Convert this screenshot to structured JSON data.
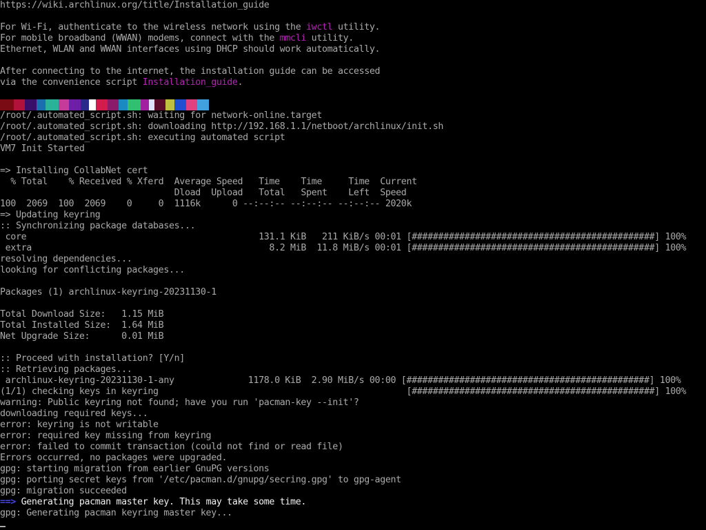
{
  "banner": {
    "url": "https://wiki.archlinux.org/title/Installation_guide",
    "wifi_pre": "For Wi-Fi, authenticate to the wireless network using the ",
    "wifi_tool": "iwctl",
    "wifi_post": " utility.",
    "wwan_pre": "For mobile broadband (WWAN) modems, connect with the ",
    "wwan_tool": "mmcli",
    "wwan_post": " utility.",
    "dhcp": "Ethernet, WLAN and WWAN interfaces using DHCP should work automatically.",
    "guide_line1": "After connecting to the internet, the installation guide can be accessed",
    "guide_pre": "via the convenience script ",
    "guide_script": "Installation_guide",
    "guide_post": "."
  },
  "glitch_colors": [
    "#7a0a14",
    "#b0123a",
    "#3a0f6a",
    "#1b6fb0",
    "#2bb39a",
    "#c63a9a",
    "#6d1fa8",
    "#2a2a8a",
    "#ffffff",
    "#d41c4c",
    "#8a1a6a",
    "#1a8ac0",
    "#30c070",
    "#a020a0",
    "#e0e0ff",
    "#5a0a2a",
    "#c0c040",
    "#2050d0",
    "#e04080",
    "#40a0e0"
  ],
  "script_lines": [
    "/root/.automated_script.sh: waiting for network-online.target",
    "/root/.automated_script.sh: downloading http://192.168.1.1/netboot/archlinux/init.sh",
    "/root/.automated_script.sh: executing automated script",
    "VM7 Init Started"
  ],
  "curl": {
    "title": "=> Installing CollabNet cert",
    "header1": "  % Total    % Received % Xferd  Average Speed   Time    Time     Time  Current",
    "header2": "                                 Dload  Upload   Total   Spent    Left  Speed",
    "row": "100  2069  100  2069    0     0  1116k      0 --:--:-- --:--:-- --:--:-- 2020k"
  },
  "pacman": {
    "keyring_header": "=> Updating keyring",
    "sync": ":: Synchronizing package databases...",
    "core": " core                                            131.1 KiB   211 KiB/s 00:01 [##############################################] 100%",
    "extra": " extra                                             8.2 MiB  11.8 MiB/s 00:01 [##############################################] 100%",
    "resolving": "resolving dependencies...",
    "conflicts": "looking for conflicting packages...",
    "packages": "Packages (1) archlinux-keyring-20231130-1",
    "total_download": "Total Download Size:   1.15 MiB",
    "total_installed": "Total Installed Size:  1.64 MiB",
    "net_upgrade": "Net Upgrade Size:      0.01 MiB",
    "proceed": ":: Proceed with installation? [Y/n]",
    "retrieving": ":: Retrieving packages...",
    "pkg_row": " archlinux-keyring-20231130-1-any              1178.0 KiB  2.90 MiB/s 00:00 [##############################################] 100%",
    "checking": "(1/1) checking keys in keyring                                               [##############################################] 100%",
    "warning": "warning: Public keyring not found; have you run 'pacman-key --init'?",
    "downloading_keys": "downloading required keys...",
    "err1": "error: keyring is not writable",
    "err2": "error: required key missing from keyring",
    "err3": "error: failed to commit transaction (could not find or read file)",
    "errors_occurred": "Errors occurred, no packages were upgraded.",
    "gpg1": "gpg: starting migration from earlier GnuPG versions",
    "gpg2": "gpg: porting secret keys from '/etc/pacman.d/gnupg/secring.gpg' to gpg-agent",
    "gpg3": "gpg: migration succeeded",
    "master_arrow": "==>",
    "master_text": " Generating pacman master key. This may take some time.",
    "gpg4": "gpg: Generating pacman keyring master key..."
  }
}
